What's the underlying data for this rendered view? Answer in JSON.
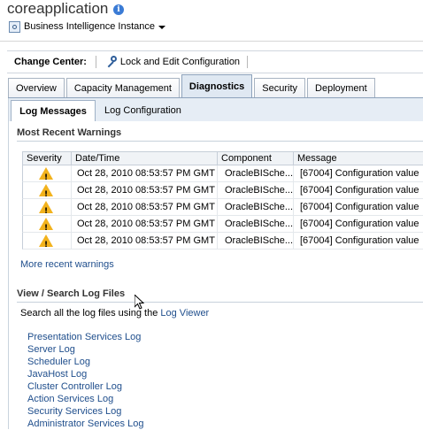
{
  "header": {
    "title": "coreapplication",
    "target_label": "Business Intelligence Instance"
  },
  "change_center": {
    "label": "Change Center:",
    "lock_button": "Lock and Edit Configuration"
  },
  "tabs": [
    {
      "label": "Overview",
      "active": false
    },
    {
      "label": "Capacity Management",
      "active": false
    },
    {
      "label": "Diagnostics",
      "active": true
    },
    {
      "label": "Security",
      "active": false
    },
    {
      "label": "Deployment",
      "active": false
    }
  ],
  "subtabs": [
    {
      "label": "Log Messages",
      "active": true
    },
    {
      "label": "Log Configuration",
      "active": false
    }
  ],
  "warnings": {
    "title": "Most Recent Warnings",
    "columns": [
      "Severity",
      "Date/Time",
      "Component",
      "Message"
    ],
    "rows": [
      {
        "datetime": "Oct 28, 2010 08:53:57 PM GMT",
        "component": "OracleBISche...",
        "message": "[67004] Configuration value"
      },
      {
        "datetime": "Oct 28, 2010 08:53:57 PM GMT",
        "component": "OracleBISche...",
        "message": "[67004] Configuration value"
      },
      {
        "datetime": "Oct 28, 2010 08:53:57 PM GMT",
        "component": "OracleBISche...",
        "message": "[67004] Configuration value"
      },
      {
        "datetime": "Oct 28, 2010 08:53:57 PM GMT",
        "component": "OracleBISche...",
        "message": "[67004] Configuration value"
      },
      {
        "datetime": "Oct 28, 2010 08:53:57 PM GMT",
        "component": "OracleBISche...",
        "message": "[67004] Configuration value"
      }
    ],
    "more_link": "More recent warnings"
  },
  "logs": {
    "title": "View / Search Log Files",
    "intro_text": "Search all the log files using the",
    "intro_link": "Log Viewer",
    "links": [
      "Presentation Services Log",
      "Server Log",
      "Scheduler Log",
      "JavaHost Log",
      "Cluster Controller Log",
      "Action Services Log",
      "Security Services Log",
      "Administrator Services Log"
    ]
  },
  "colors": {
    "link": "#1f4e8c",
    "warning": "#f2b21d",
    "tab_active_bg": "#dfe8f2"
  }
}
